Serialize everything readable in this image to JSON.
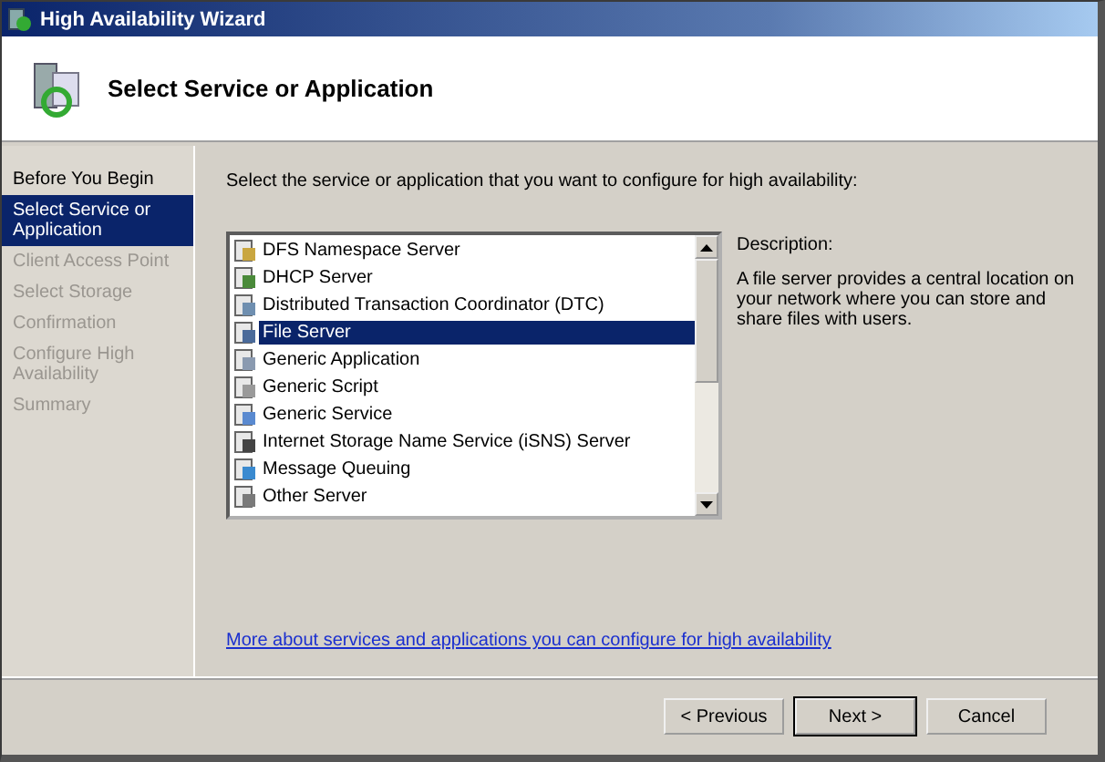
{
  "window": {
    "title": "High Availability Wizard"
  },
  "header": {
    "title": "Select Service or Application"
  },
  "steps": [
    {
      "label": "Before You Begin",
      "selected": false,
      "disabled": false
    },
    {
      "label": "Select Service or Application",
      "selected": true,
      "disabled": false
    },
    {
      "label": "Client Access Point",
      "selected": false,
      "disabled": true
    },
    {
      "label": "Select Storage",
      "selected": false,
      "disabled": true
    },
    {
      "label": "Confirmation",
      "selected": false,
      "disabled": true
    },
    {
      "label": "Configure High Availability",
      "selected": false,
      "disabled": true
    },
    {
      "label": "Summary",
      "selected": false,
      "disabled": true
    }
  ],
  "instruction": "Select the service or application that you want to configure for high availability:",
  "services": [
    {
      "label": "DFS Namespace Server",
      "selected": false
    },
    {
      "label": "DHCP Server",
      "selected": false
    },
    {
      "label": "Distributed Transaction Coordinator (DTC)",
      "selected": false
    },
    {
      "label": "File Server",
      "selected": true
    },
    {
      "label": "Generic Application",
      "selected": false
    },
    {
      "label": "Generic Script",
      "selected": false
    },
    {
      "label": "Generic Service",
      "selected": false
    },
    {
      "label": "Internet Storage Name Service (iSNS) Server",
      "selected": false
    },
    {
      "label": "Message Queuing",
      "selected": false
    },
    {
      "label": "Other Server",
      "selected": false
    }
  ],
  "description": {
    "label": "Description:",
    "text": "A file server provides a central location on your network where you can store and share files with users."
  },
  "link": "More about services and applications you can configure for high availability",
  "buttons": [
    {
      "label": "< Previous",
      "default": false
    },
    {
      "label": "Next >",
      "default": true
    },
    {
      "label": "Cancel",
      "default": false
    }
  ]
}
